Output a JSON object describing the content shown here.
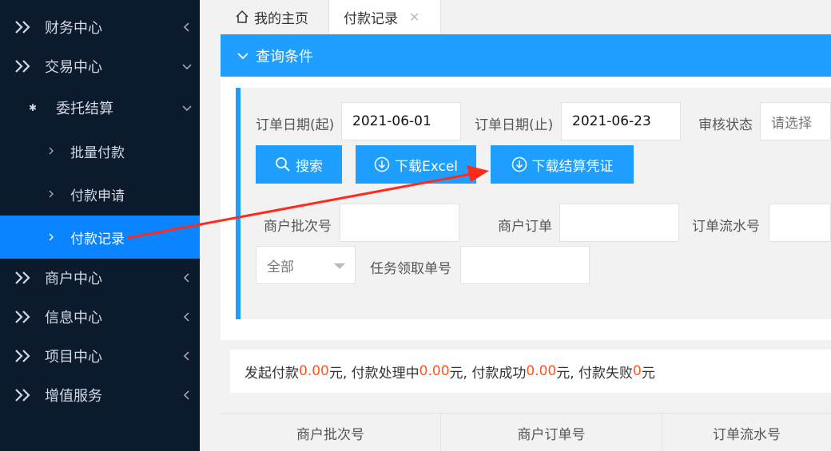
{
  "sidebar": {
    "items": [
      {
        "label": "财务中心",
        "arrow": "left"
      },
      {
        "label": "交易中心",
        "arrow": "down"
      },
      {
        "label": "委托结算",
        "arrow": "down",
        "icon": "palm-icon"
      },
      {
        "label": "批量付款"
      },
      {
        "label": "付款申请"
      },
      {
        "label": "付款记录",
        "active": true
      },
      {
        "label": "商户中心",
        "arrow": "left"
      },
      {
        "label": "信息中心",
        "arrow": "left"
      },
      {
        "label": "项目中心",
        "arrow": "left"
      },
      {
        "label": "增值服务",
        "arrow": "left"
      }
    ]
  },
  "tabs": {
    "home": "我的主页",
    "payment_records": "付款记录",
    "close_glyph": "✕"
  },
  "query": {
    "title": "查询条件",
    "order_date_start_label": "订单日期(起)",
    "order_date_start_value": "2021-06-01",
    "order_date_end_label": "订单日期(止)",
    "order_date_end_value": "2021-06-23",
    "audit_status_label": "审核状态",
    "audit_status_placeholder": "请选择",
    "search_button": "搜索",
    "download_excel_button": "下载Excel",
    "download_voucher_button": "下载结算凭证",
    "merchant_batch_label": "商户批次号",
    "merchant_order_label": "商户订单",
    "order_serial_label": "订单流水号",
    "scope_select_value": "全部",
    "task_receipt_label": "任务领取单号"
  },
  "summary": {
    "initiated_label": "发起付款",
    "initiated_amount": "0.00",
    "processing_label": "元, 付款处理中",
    "processing_amount": "0.00",
    "success_label": "元, 付款成功",
    "success_amount": "0.00",
    "failed_label": "元, 付款失败",
    "failed_amount": "0",
    "tail": "元"
  },
  "table": {
    "headers": [
      "商户批次号",
      "商户订单号",
      "订单流水号"
    ]
  },
  "colors": {
    "sidebar_bg": "#0c1a2e",
    "accent": "#1e9fff",
    "active_nav": "#0a84ff",
    "amount": "#ff5722",
    "annotation_arrow": "#ff2a1a"
  }
}
